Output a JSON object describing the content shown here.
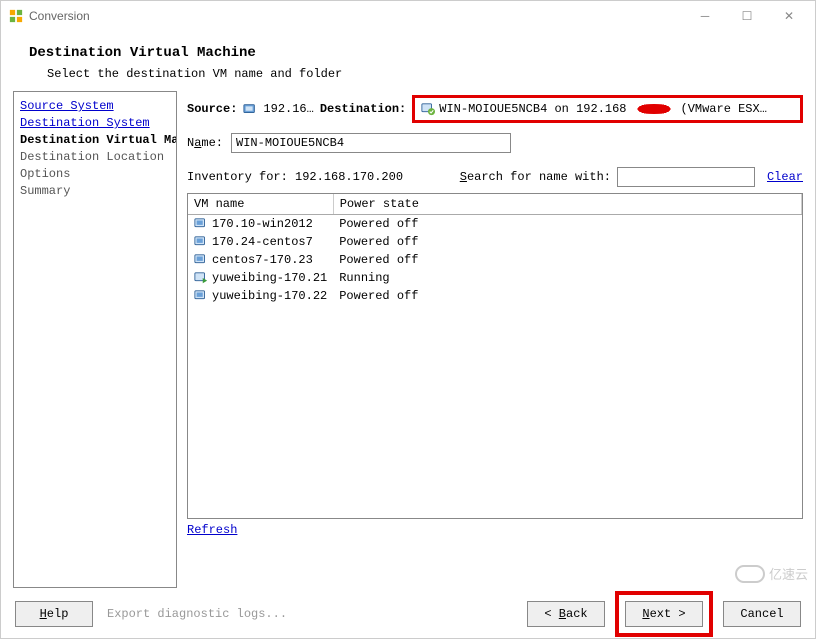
{
  "window": {
    "title": "Conversion"
  },
  "wizard": {
    "heading": "Destination Virtual Machine",
    "subtitle": "Select the destination VM name and folder"
  },
  "sidebar": {
    "items": [
      {
        "label": "Source System",
        "state": "done"
      },
      {
        "label": "Destination System",
        "state": "done"
      },
      {
        "label": "Destination Virtual Machine",
        "state": "current"
      },
      {
        "label": "Destination Location",
        "state": "pending"
      },
      {
        "label": "Options",
        "state": "pending"
      },
      {
        "label": "Summary",
        "state": "pending"
      }
    ]
  },
  "main": {
    "source_label": "Source:",
    "source_value": "192.16…",
    "destination_label": "Destination:",
    "destination_value_pre": "WIN-MOIOUE5NCB4 on 192.168",
    "destination_value_post": "(VMware ESX…",
    "name_label": "Name:",
    "name_value": "WIN-MOIOUE5NCB4",
    "inventory_label": "Inventory for: 192.168.170.200",
    "search_label_pre": "S",
    "search_label_post": "earch for name with:",
    "search_value": "",
    "clear_label": "Clear",
    "refresh_label": "Refresh",
    "table": {
      "col_vm": "VM name",
      "col_power": "Power state",
      "rows": [
        {
          "name": "170.10-win2012",
          "power": "Powered off",
          "running": false
        },
        {
          "name": "170.24-centos7",
          "power": "Powered off",
          "running": false
        },
        {
          "name": "centos7-170.23",
          "power": "Powered off",
          "running": false
        },
        {
          "name": "yuweibing-170.21",
          "power": "Running",
          "running": true
        },
        {
          "name": "yuweibing-170.22",
          "power": "Powered off",
          "running": false
        }
      ]
    }
  },
  "footer": {
    "help_u": "H",
    "help_rest": "elp",
    "diag": "Export diagnostic logs...",
    "back_pre": "< ",
    "back_u": "B",
    "back_post": "ack",
    "next_u": "N",
    "next_post": "ext >",
    "cancel": "Cancel"
  },
  "watermark": "亿速云"
}
